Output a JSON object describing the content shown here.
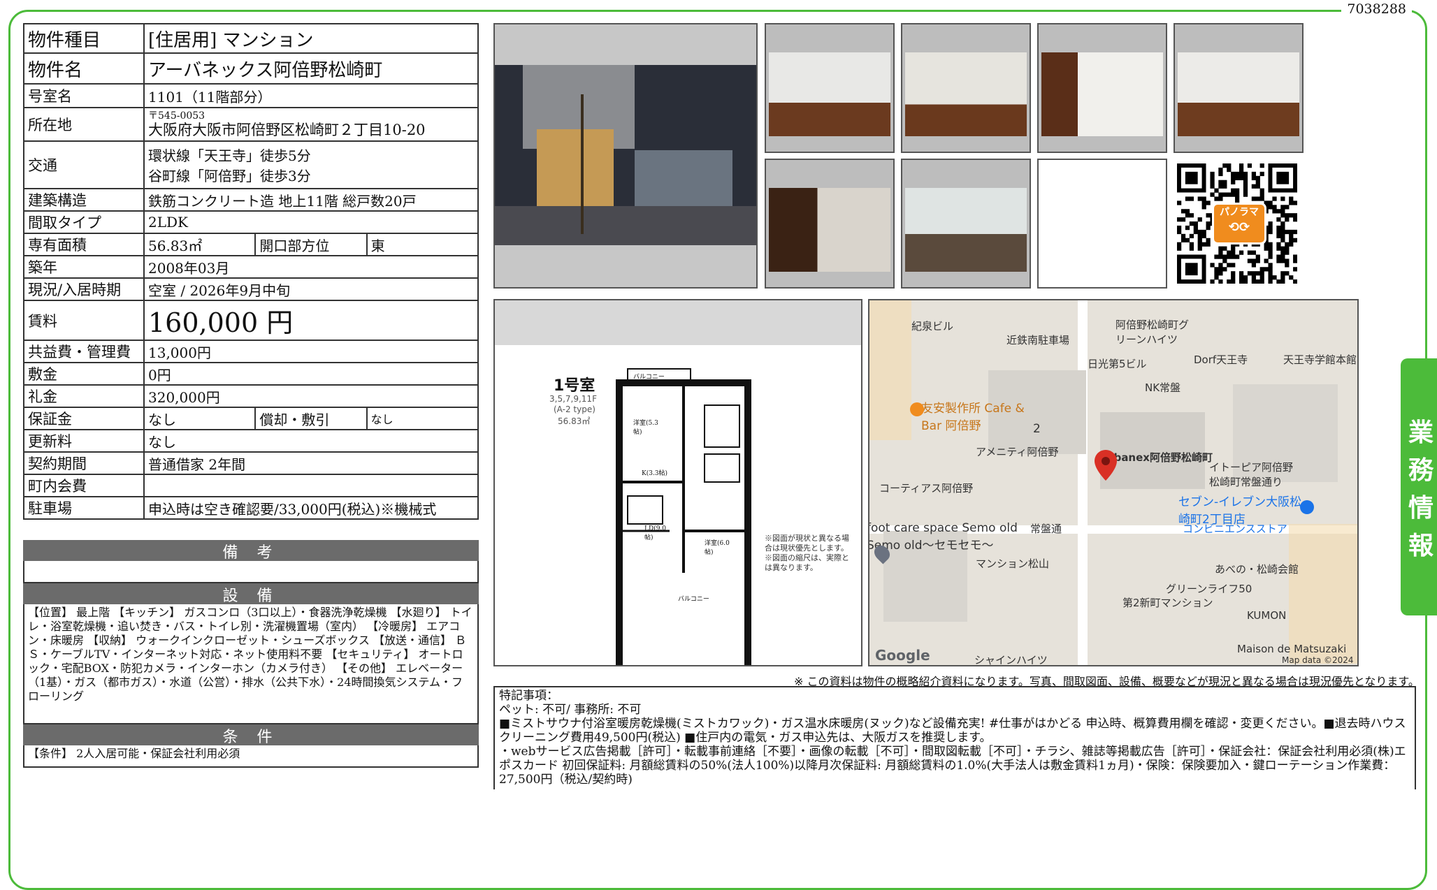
{
  "doc_id": "7038288",
  "side_tab": "業務情報",
  "property": {
    "type_label": "物件種目",
    "type_value": "[住居用]  マンション",
    "name_label": "物件名",
    "name_value": "アーバネックス阿倍野松崎町",
    "room_label": "号室名",
    "room_value": "1101（11階部分）",
    "address_label": "所在地",
    "postal": "〒545-0053",
    "address_value": "大阪府大阪市阿倍野区松崎町２丁目10-20",
    "traffic_label": "交通",
    "traffic_1": "環状線「天王寺」徒歩5分",
    "traffic_2": "谷町線「阿倍野」徒歩3分",
    "structure_label": "建築構造",
    "structure_value": "鉄筋コンクリート造  地上11階  総戸数20戸",
    "layout_label": "間取タイプ",
    "layout_value": "2LDK",
    "area_label": "専有面積",
    "area_value": "56.83㎡",
    "direction_label": "開口部方位",
    "direction_value": "東",
    "built_label": "築年",
    "built_value": "2008年03月",
    "status_label": "現況/入居時期",
    "status_value": "空室  /  2026年9月中旬",
    "rent_label": "賃料",
    "rent_value": "160,000 円",
    "fee_label": "共益費・管理費",
    "fee_value": "13,000円",
    "deposit_label": "敷金",
    "deposit_value": "0円",
    "key_money_label": "礼金",
    "key_money_value": "320,000円",
    "guarantee_label": "保証金",
    "guarantee_value": "なし",
    "amort_label": "償却・敷引",
    "amort_value": "なし",
    "renewal_label": "更新料",
    "renewal_value": "なし",
    "contract_label": "契約期間",
    "contract_value": "普通借家  2年間",
    "community_label": "町内会費",
    "community_value": "",
    "parking_label": "駐車場",
    "parking_value": "申込時は空き確認要/33,000円(税込)※機械式"
  },
  "remarks_title": "備 考",
  "equipment_title": "設 備",
  "equipment_text": "【位置】 最上階 【キッチン】 ガスコンロ（3口以上）・食器洗浄乾燥機 【水廻り】 トイレ・浴室乾燥機・追い焚き・バス・トイレ別・洗濯機置場（室内） 【冷暖房】 エアコン・床暖房 【収納】 ウォークインクローゼット・シューズボックス 【放送・通信】 ＢＳ・ケーブルTV・インターネット対応・ネット使用料不要 【セキュリティ】 オートロック・宅配BOX・防犯カメラ・インターホン（カメラ付き） 【その他】 エレベーター（1基）・ガス（都市ガス）・水道（公営）・排水（公共下水）・24時間換気システム・フローリング",
  "conditions_title": "条 件",
  "conditions_text": "【条件】 2人入居可能・保証会社利用必須",
  "qr_label": "パノラマ",
  "floorplan": {
    "room_title": "1号室",
    "floors": "3,5,7,9,11F",
    "type": "(A-2 type)",
    "area": "56.83㎡",
    "balcony": "バルコニー",
    "rooms": [
      "洋室(5.3帖)",
      "K(3.3帖)",
      "LD(9.0帖)",
      "洋室(6.0帖)"
    ],
    "disclaimer": "※図面が現状と異なる場合は現状優先とします。※図面の縮尺は、実際とは異なります。"
  },
  "map": {
    "labels": [
      "紀泉ビル",
      "近鉄南駐車場",
      "阿倍野松崎町グリーンハイツ",
      "日光第5ビル",
      "Dorf天王寺",
      "天王寺学館本館",
      "NK常盤",
      "友安製作所 Cafe & Bar 阿倍野",
      "アメニティ阿倍野",
      "Urbanex阿倍野松崎町",
      "イトーピア阿倍野松崎町常盤通り",
      "コーティアス阿倍野",
      "セブン-イレブン大阪松崎町2丁目店",
      "コンビニエンスストア",
      "foot care space Semo old",
      "Semo old〜セモセモ〜",
      "常盤通",
      "マンション松山",
      "あべの・松崎会館",
      "グリーンライフ50",
      "第2新町マンション",
      "KUMON",
      "シャインハイツ",
      "Maison de Matsuzaki",
      "Google",
      "Map data ©2024",
      "2"
    ]
  },
  "note": "※ この資料は物件の概略紹介資料になります。写真、間取図面、設備、概要などが現況と異なる場合は現況優先となります。",
  "special": {
    "title": "特記事項：",
    "line1": "ペット: 不可/ 事務所: 不可",
    "line2": "■ミストサウナ付浴室暖房乾燥機(ミストカワック)・ガス温水床暖房(ヌック)など設備充実! #仕事がはかどる 申込時、概算費用欄を確認・変更ください。■退去時ハウスクリーニング費用49,500円(税込) ■住戸内の電気・ガス申込先は、大阪ガスを推奨します。",
    "line3": "・webサービス広告掲載［許可］・転載事前連絡［不要］・画像の転載［不可］・間取図転載［不可］・チラシ、雑誌等掲載広告［許可］・保証会社：保証会社利用必須(株)エポスカード 初回保証料: 月額総賃料の50%(法人100%)以降月次保証料: 月額総賃料の1.0%(大手法人は敷金賃料1ヵ月)・保険：保険要加入・鍵ローテーション作業費：27,500円（税込/契約時)"
  },
  "colors": {
    "accent": "#4cbb3a",
    "section": "#6b6b6b",
    "pin": "#d93025"
  }
}
